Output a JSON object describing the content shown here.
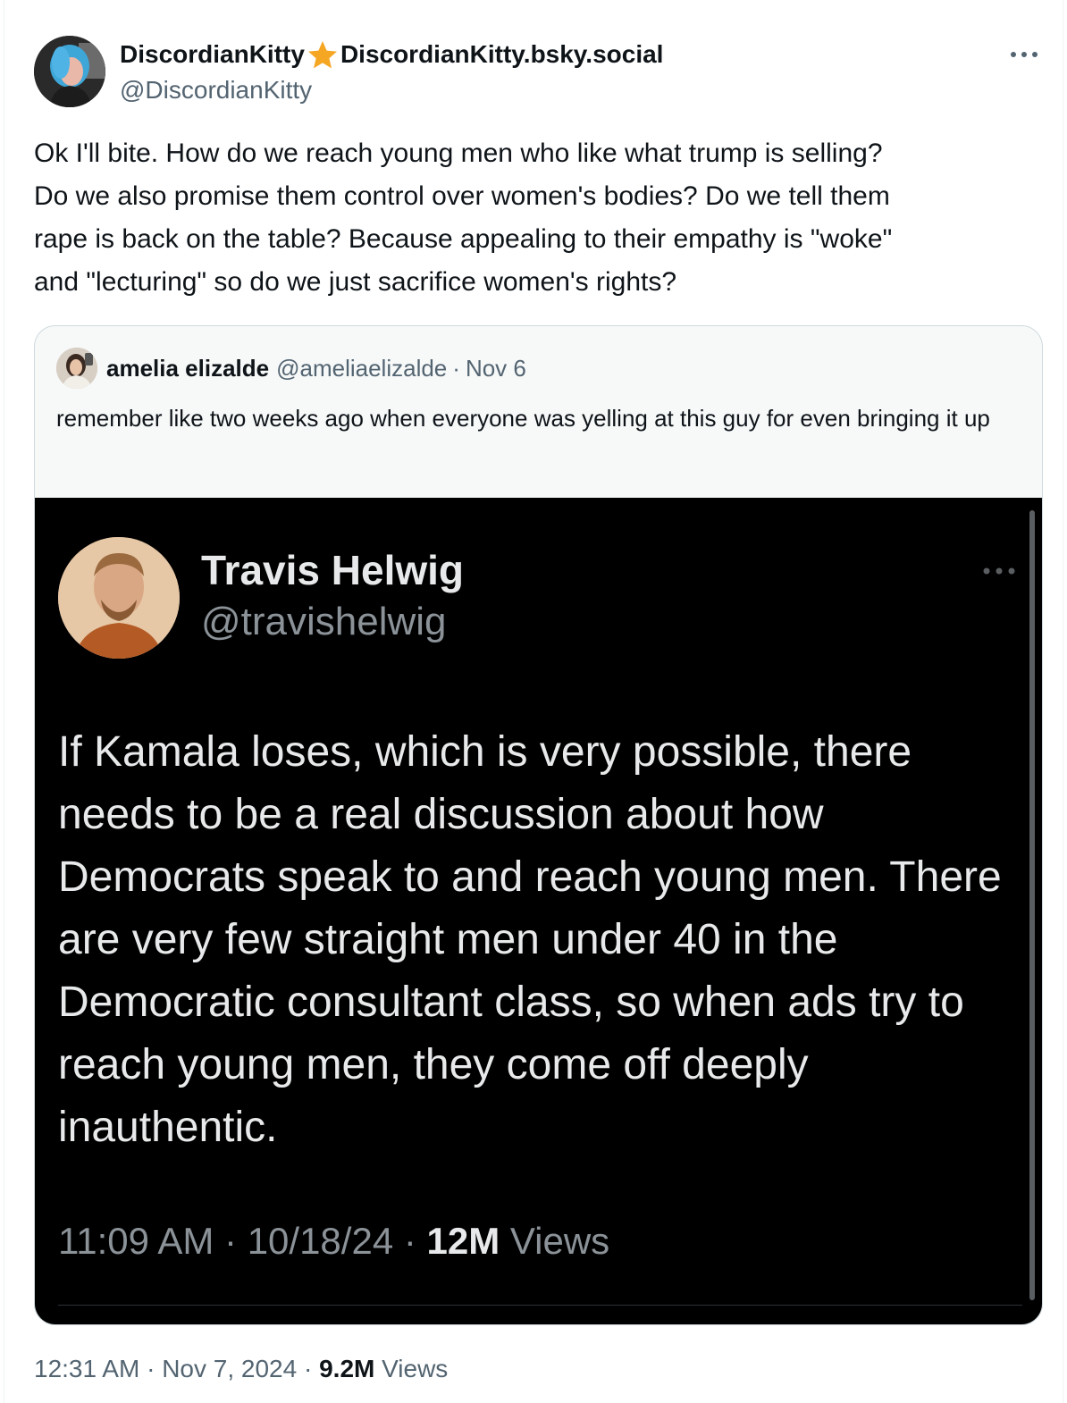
{
  "author": {
    "display_name_part1": "DiscordianKitty",
    "display_name_part2": "DiscordianKitty.bsky.social",
    "handle": "@DiscordianKitty",
    "star_icon": "star-emoji",
    "star_color": "#f5a623"
  },
  "tweet": {
    "text": "Ok I'll bite. How do we reach young men who like what trump is selling?\nDo we also promise them control over women's bodies? Do we tell them\nrape is back on the table? Because appealing to their empathy is \"woke\"\nand \"lecturing\" so do we just sacrifice women's rights?"
  },
  "quote": {
    "name": "amelia elizalde",
    "handle": "@ameliaelizalde",
    "separator": "·",
    "date": "Nov 6",
    "text": "remember like two weeks ago when everyone was yelling at this guy for even bringing it up",
    "screenshot": {
      "name": "Travis Helwig",
      "handle": "@travishelwig",
      "text": "If Kamala loses, which is very possible, there needs to be a real discussion about how Democrats speak to and reach young men. There are very few straight men under 40 in the Democratic consultant class, so when ads try to reach young men, they come off deeply inauthentic.",
      "time": "11:09 AM",
      "sep1": "·",
      "date": "10/18/24",
      "sep2": "·",
      "views_count": "12M",
      "views_label": "Views"
    }
  },
  "footer": {
    "time": "12:31 AM",
    "sep1": "·",
    "date": "Nov 7, 2024",
    "sep2": "·",
    "views_count": "9.2M",
    "views_label": "Views"
  },
  "colors": {
    "text_primary": "#0f1419",
    "text_secondary": "#536471",
    "border": "#cfd9de",
    "media_bg": "#000000"
  }
}
